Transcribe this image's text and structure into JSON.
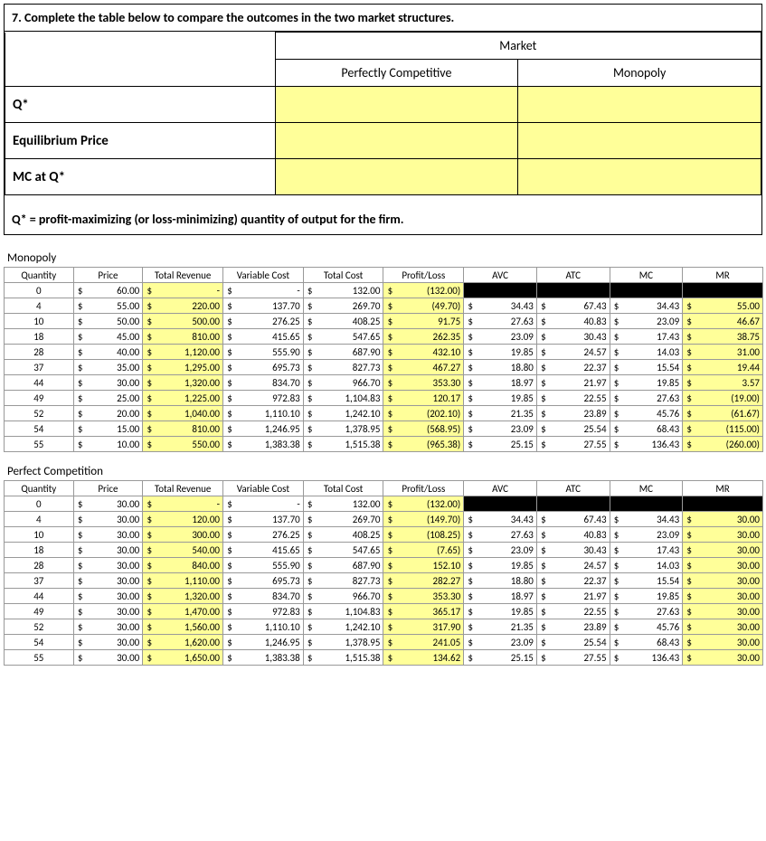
{
  "question": {
    "title": "7. Complete the table below to compare the outcomes in the two market structures.",
    "market_header": "Market",
    "col_pc": "Perfectly Competitive",
    "col_mon": "Monopoly",
    "row_qstar": "Q*",
    "row_eqprice": "Equilibrium Price",
    "row_mcq": "MC at Q*",
    "footnote": "Q* = profit-maximizing (or loss-minimizing) quantity of output for the firm."
  },
  "headers": [
    "Quantity",
    "Price",
    "Total Revenue",
    "Variable Cost",
    "Total Cost",
    "Profit/Loss",
    "AVC",
    "ATC",
    "MC",
    "MR"
  ],
  "monopoly": {
    "title": "Monopoly",
    "rows": [
      {
        "q": 0,
        "price": "60.00",
        "tr": "-",
        "vc": "-",
        "tc": "132.00",
        "pl": "(132.00)",
        "avc": "",
        "atc": "",
        "mc": "",
        "mr": ""
      },
      {
        "q": 4,
        "price": "55.00",
        "tr": "220.00",
        "vc": "137.70",
        "tc": "269.70",
        "pl": "(49.70)",
        "avc": "34.43",
        "atc": "67.43",
        "mc": "34.43",
        "mr": "55.00"
      },
      {
        "q": 10,
        "price": "50.00",
        "tr": "500.00",
        "vc": "276.25",
        "tc": "408.25",
        "pl": "91.75",
        "avc": "27.63",
        "atc": "40.83",
        "mc": "23.09",
        "mr": "46.67"
      },
      {
        "q": 18,
        "price": "45.00",
        "tr": "810.00",
        "vc": "415.65",
        "tc": "547.65",
        "pl": "262.35",
        "avc": "23.09",
        "atc": "30.43",
        "mc": "17.43",
        "mr": "38.75"
      },
      {
        "q": 28,
        "price": "40.00",
        "tr": "1,120.00",
        "vc": "555.90",
        "tc": "687.90",
        "pl": "432.10",
        "avc": "19.85",
        "atc": "24.57",
        "mc": "14.03",
        "mr": "31.00"
      },
      {
        "q": 37,
        "price": "35.00",
        "tr": "1,295.00",
        "vc": "695.73",
        "tc": "827.73",
        "pl": "467.27",
        "avc": "18.80",
        "atc": "22.37",
        "mc": "15.54",
        "mr": "19.44"
      },
      {
        "q": 44,
        "price": "30.00",
        "tr": "1,320.00",
        "vc": "834.70",
        "tc": "966.70",
        "pl": "353.30",
        "avc": "18.97",
        "atc": "21.97",
        "mc": "19.85",
        "mr": "3.57"
      },
      {
        "q": 49,
        "price": "25.00",
        "tr": "1,225.00",
        "vc": "972.83",
        "tc": "1,104.83",
        "pl": "120.17",
        "avc": "19.85",
        "atc": "22.55",
        "mc": "27.63",
        "mr": "(19.00)"
      },
      {
        "q": 52,
        "price": "20.00",
        "tr": "1,040.00",
        "vc": "1,110.10",
        "tc": "1,242.10",
        "pl": "(202.10)",
        "avc": "21.35",
        "atc": "23.89",
        "mc": "45.76",
        "mr": "(61.67)"
      },
      {
        "q": 54,
        "price": "15.00",
        "tr": "810.00",
        "vc": "1,246.95",
        "tc": "1,378.95",
        "pl": "(568.95)",
        "avc": "23.09",
        "atc": "25.54",
        "mc": "68.43",
        "mr": "(115.00)"
      },
      {
        "q": 55,
        "price": "10.00",
        "tr": "550.00",
        "vc": "1,383.38",
        "tc": "1,515.38",
        "pl": "(965.38)",
        "avc": "25.15",
        "atc": "27.55",
        "mc": "136.43",
        "mr": "(260.00)"
      }
    ]
  },
  "pc": {
    "title": "Perfect Competition",
    "rows": [
      {
        "q": 0,
        "price": "30.00",
        "tr": "-",
        "vc": "-",
        "tc": "132.00",
        "pl": "(132.00)",
        "avc": "",
        "atc": "",
        "mc": "",
        "mr": ""
      },
      {
        "q": 4,
        "price": "30.00",
        "tr": "120.00",
        "vc": "137.70",
        "tc": "269.70",
        "pl": "(149.70)",
        "avc": "34.43",
        "atc": "67.43",
        "mc": "34.43",
        "mr": "30.00"
      },
      {
        "q": 10,
        "price": "30.00",
        "tr": "300.00",
        "vc": "276.25",
        "tc": "408.25",
        "pl": "(108.25)",
        "avc": "27.63",
        "atc": "40.83",
        "mc": "23.09",
        "mr": "30.00"
      },
      {
        "q": 18,
        "price": "30.00",
        "tr": "540.00",
        "vc": "415.65",
        "tc": "547.65",
        "pl": "(7.65)",
        "avc": "23.09",
        "atc": "30.43",
        "mc": "17.43",
        "mr": "30.00"
      },
      {
        "q": 28,
        "price": "30.00",
        "tr": "840.00",
        "vc": "555.90",
        "tc": "687.90",
        "pl": "152.10",
        "avc": "19.85",
        "atc": "24.57",
        "mc": "14.03",
        "mr": "30.00"
      },
      {
        "q": 37,
        "price": "30.00",
        "tr": "1,110.00",
        "vc": "695.73",
        "tc": "827.73",
        "pl": "282.27",
        "avc": "18.80",
        "atc": "22.37",
        "mc": "15.54",
        "mr": "30.00"
      },
      {
        "q": 44,
        "price": "30.00",
        "tr": "1,320.00",
        "vc": "834.70",
        "tc": "966.70",
        "pl": "353.30",
        "avc": "18.97",
        "atc": "21.97",
        "mc": "19.85",
        "mr": "30.00"
      },
      {
        "q": 49,
        "price": "30.00",
        "tr": "1,470.00",
        "vc": "972.83",
        "tc": "1,104.83",
        "pl": "365.17",
        "avc": "19.85",
        "atc": "22.55",
        "mc": "27.63",
        "mr": "30.00"
      },
      {
        "q": 52,
        "price": "30.00",
        "tr": "1,560.00",
        "vc": "1,110.10",
        "tc": "1,242.10",
        "pl": "317.90",
        "avc": "21.35",
        "atc": "23.89",
        "mc": "45.76",
        "mr": "30.00"
      },
      {
        "q": 54,
        "price": "30.00",
        "tr": "1,620.00",
        "vc": "1,246.95",
        "tc": "1,378.95",
        "pl": "241.05",
        "avc": "23.09",
        "atc": "25.54",
        "mc": "68.43",
        "mr": "30.00"
      },
      {
        "q": 55,
        "price": "30.00",
        "tr": "1,650.00",
        "vc": "1,383.38",
        "tc": "1,515.38",
        "pl": "134.62",
        "avc": "25.15",
        "atc": "27.55",
        "mc": "136.43",
        "mr": "30.00"
      }
    ]
  },
  "chart_data": {
    "type": "table",
    "title": "Monopoly vs Perfect Competition cost/revenue data",
    "series": [
      {
        "name": "Monopoly",
        "fields": [
          "Quantity",
          "Price",
          "Total Revenue",
          "Variable Cost",
          "Total Cost",
          "Profit/Loss",
          "AVC",
          "ATC",
          "MC",
          "MR"
        ]
      },
      {
        "name": "Perfect Competition",
        "fields": [
          "Quantity",
          "Price",
          "Total Revenue",
          "Variable Cost",
          "Total Cost",
          "Profit/Loss",
          "AVC",
          "ATC",
          "MC",
          "MR"
        ]
      }
    ]
  }
}
